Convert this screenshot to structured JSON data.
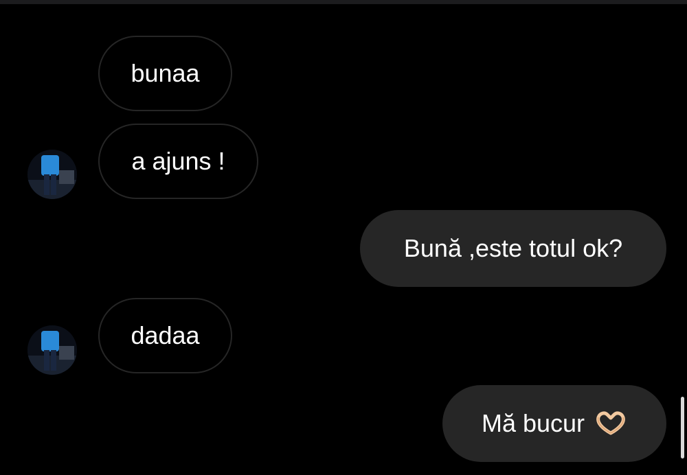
{
  "messages": [
    {
      "id": "m1",
      "direction": "incoming",
      "text": "bunaa"
    },
    {
      "id": "m2",
      "direction": "incoming",
      "text": "a ajuns !"
    },
    {
      "id": "m3",
      "direction": "outgoing",
      "text": "Bună ,este totul ok?"
    },
    {
      "id": "m4",
      "direction": "incoming",
      "text": "dadaa"
    },
    {
      "id": "m5",
      "direction": "outgoing",
      "text": "Mă bucur",
      "emoji": "heart-hands-icon"
    }
  ],
  "colors": {
    "background": "#000000",
    "incoming_border": "#262626",
    "outgoing_fill": "#262626",
    "text": "#ffffff"
  }
}
